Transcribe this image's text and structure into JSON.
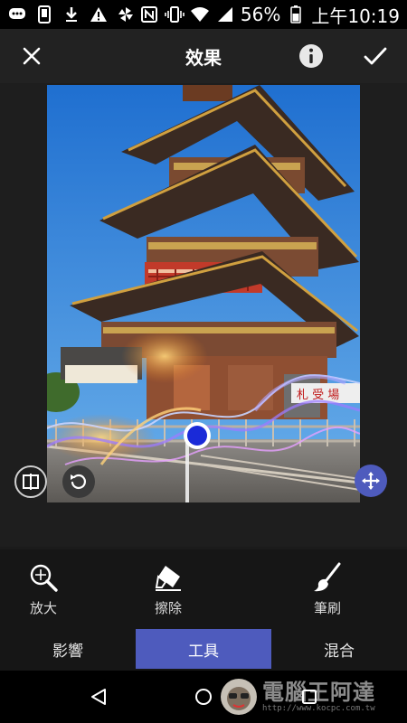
{
  "status_bar": {
    "battery_percent": "56%",
    "time": "上午10:19",
    "icons": [
      "message-icon",
      "phone-icon",
      "download-icon",
      "warning-icon",
      "pinwheel-icon",
      "nfc-icon",
      "vibrate-icon",
      "wifi-icon",
      "signal-icon",
      "battery-icon"
    ]
  },
  "header": {
    "title": "效果",
    "close_icon": "close-icon",
    "info_icon": "info-icon",
    "confirm_icon": "check-icon"
  },
  "photo_controls": {
    "compare_icon": "compare-icon",
    "undo_icon": "undo-icon",
    "move_icon": "move-icon",
    "brush_handle": "brush-position-dot"
  },
  "tools": [
    {
      "label": "放大",
      "icon": "zoom-icon"
    },
    {
      "label": "擦除",
      "icon": "eraser-icon"
    },
    {
      "label": "筆刷",
      "icon": "brush-icon"
    }
  ],
  "tabs": [
    {
      "label": "影響",
      "active": false
    },
    {
      "label": "工具",
      "active": true
    },
    {
      "label": "混合",
      "active": false
    }
  ],
  "nav_bar": [
    "back-icon",
    "home-icon",
    "recents-icon"
  ],
  "watermark": {
    "brand": "電腦王阿達",
    "url": "http://www.kocpc.com.tw"
  },
  "colors": {
    "accent": "#4e5bbd",
    "handle": "#1a2ad8",
    "sky": "#2b7fd8"
  }
}
